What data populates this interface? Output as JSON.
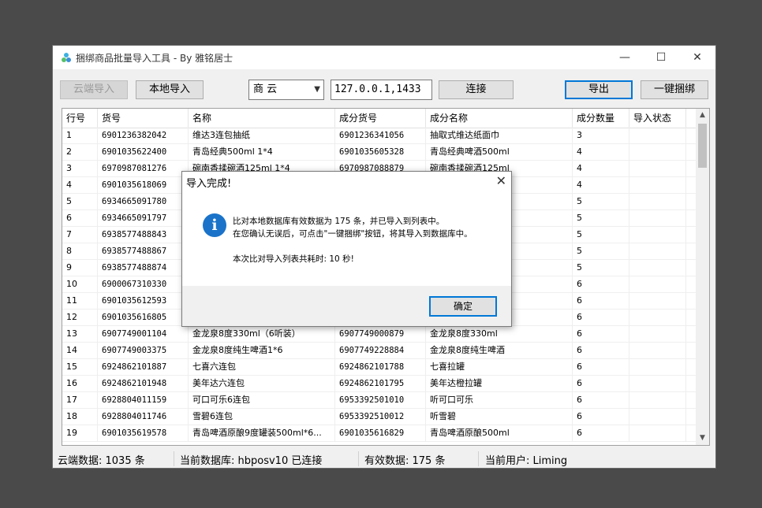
{
  "window": {
    "title": "捆绑商品批量导入工具 - By 雅铭居士",
    "minimize_glyph": "—",
    "maximize_glyph": "☐",
    "close_glyph": "✕"
  },
  "toolbar": {
    "cloud_import": "云端导入",
    "local_import": "本地导入",
    "db_select": "商 云",
    "server_value": "127.0.0.1,1433",
    "connect": "连接",
    "export": "导出",
    "bundle": "一键捆绑"
  },
  "table": {
    "headers": [
      "行号",
      "货号",
      "名称",
      "成分货号",
      "成分名称",
      "成分数量",
      "导入状态"
    ],
    "rows": [
      [
        "1",
        "6901236382042",
        "维达3连包抽纸",
        "6901236341056",
        "抽取式维达纸面巾",
        "3",
        ""
      ],
      [
        "2",
        "6901035622400",
        "青岛经典500ml 1*4",
        "6901035605328",
        "青岛经典啤酒500ml",
        "4",
        ""
      ],
      [
        "3",
        "6970987081276",
        "碗南香揉碗酒125ml 1*4",
        "6970987088879",
        "碗南香揉碗酒125ml",
        "4",
        ""
      ],
      [
        "4",
        "6901035618069",
        "",
        "",
        "0ml",
        "4",
        ""
      ],
      [
        "5",
        "6934665091780",
        "",
        "",
        "预制杯",
        "5",
        ""
      ],
      [
        "6",
        "6934665091797",
        "",
        "",
        "预制杯",
        "5",
        ""
      ],
      [
        "7",
        "6938577488843",
        "",
        "",
        "g/杯",
        "5",
        ""
      ],
      [
        "8",
        "6938577488867",
        "",
        "",
        "g/杯",
        "5",
        ""
      ],
      [
        "9",
        "6938577488874",
        "",
        "",
        "g/杯",
        "5",
        ""
      ],
      [
        "10",
        "6900067310330",
        "",
        "",
        "乳饮料",
        "6",
        ""
      ],
      [
        "11",
        "6901035612593",
        "",
        "",
        "0ml",
        "6",
        ""
      ],
      [
        "12",
        "6901035616805",
        "",
        "",
        "",
        "6",
        ""
      ],
      [
        "13",
        "6907749001104",
        "金龙泉8度330ml（6听装）",
        "6907749000879",
        "金龙泉8度330ml",
        "6",
        ""
      ],
      [
        "14",
        "6907749003375",
        "金龙泉8度纯生啤酒1*6",
        "6907749228884",
        "金龙泉8度纯生啤酒",
        "6",
        ""
      ],
      [
        "15",
        "6924862101887",
        "七喜六连包",
        "6924862101788",
        "七喜拉罐",
        "6",
        ""
      ],
      [
        "16",
        "6924862101948",
        "美年达六连包",
        "6924862101795",
        "美年达橙拉罐",
        "6",
        ""
      ],
      [
        "17",
        "6928804011159",
        "可口可乐6连包",
        "6953392501010",
        "听可口可乐",
        "6",
        ""
      ],
      [
        "18",
        "6928804011746",
        "雪碧6连包",
        "6953392510012",
        "听雪碧",
        "6",
        ""
      ],
      [
        "19",
        "6901035619578",
        "青岛啤酒原酿9度罐装500ml*6...",
        "6901035616829",
        "青岛啤酒原酿500ml",
        "6",
        ""
      ]
    ]
  },
  "statusbar": {
    "cloud": "云端数据: 1035 条",
    "db": "当前数据库: hbposv10 已连接",
    "valid": "有效数据: 175 条",
    "user": "当前用户: Liming"
  },
  "dialog": {
    "title": "导入完成!",
    "close_glyph": "✕",
    "icon": "i",
    "line1": "比对本地数据库有效数据为 175 条，并已导入到列表中。",
    "line2": "在您确认无误后，可点击\"一键捆绑\"按钮，将其导入到数据库中。",
    "line3": "本次比对导入列表共耗时: 10 秒!",
    "ok": "确定"
  },
  "colors": {
    "accent": "#0078d7",
    "info_icon": "#1a73c9",
    "backdrop": "#4a4a4a"
  }
}
